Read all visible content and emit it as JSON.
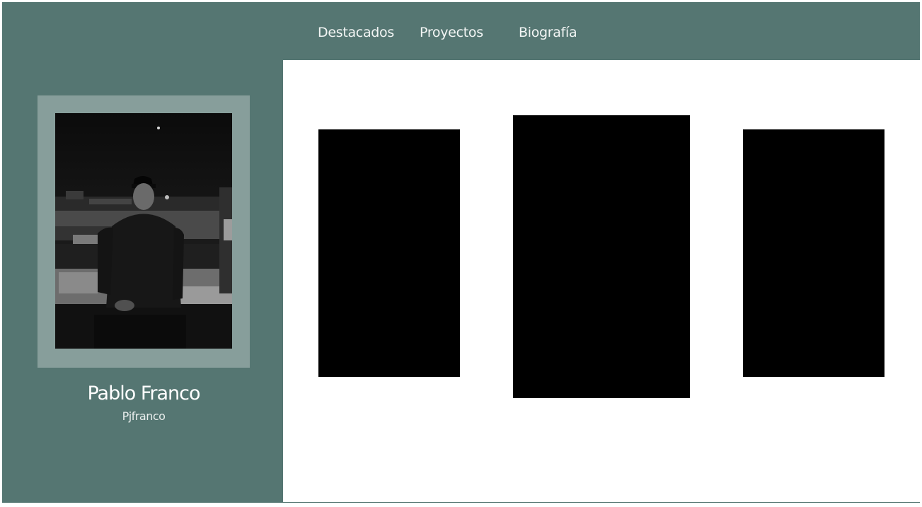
{
  "nav": {
    "items": [
      {
        "label": "Destacados"
      },
      {
        "label": "Proyectos"
      },
      {
        "label": "Biografía"
      }
    ]
  },
  "profile": {
    "name": "Pablo Franco",
    "handle": "Pjfranco",
    "photo_icon": "profile-photo"
  },
  "theme": {
    "background": "#557672",
    "frame_accent": "#879e9b",
    "panel": "#ffffff",
    "card": "#000000"
  },
  "gallery": {
    "cards": [
      {
        "id": "card-1"
      },
      {
        "id": "card-2"
      },
      {
        "id": "card-3"
      }
    ]
  }
}
